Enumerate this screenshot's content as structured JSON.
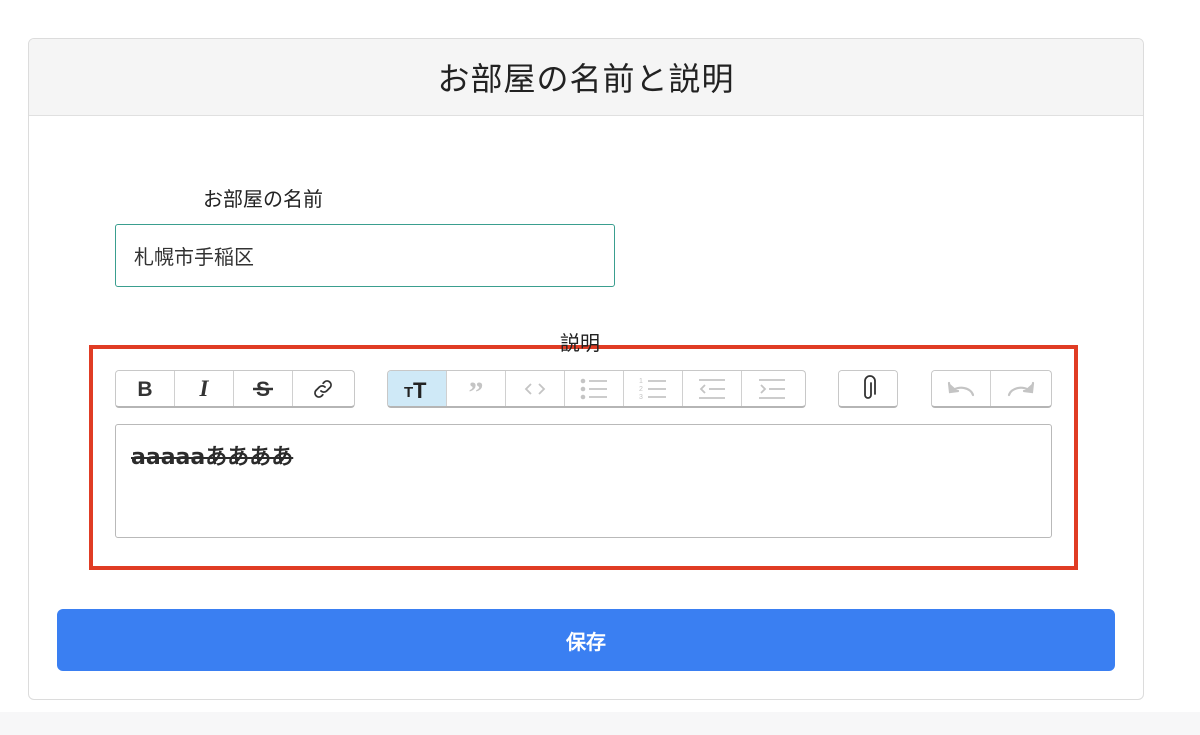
{
  "header": {
    "title": "お部屋の名前と説明"
  },
  "form": {
    "name_label": "お部屋の名前",
    "name_value": "札幌市手稲区",
    "description_label": "説明",
    "description_text": "aaaaaああああ",
    "save_label": "保存"
  },
  "toolbar": {
    "groups": [
      {
        "name": "text-format",
        "buttons": [
          "bold-icon",
          "italic-icon",
          "strikethrough-icon",
          "link-icon"
        ]
      },
      {
        "name": "block-format",
        "buttons": [
          "heading-icon",
          "quote-icon",
          "code-icon",
          "bullet-list-icon",
          "numbered-list-icon",
          "outdent-icon",
          "indent-icon"
        ]
      },
      {
        "name": "files",
        "buttons": [
          "attach-icon"
        ]
      },
      {
        "name": "history",
        "buttons": [
          "undo-icon",
          "redo-icon"
        ]
      }
    ],
    "active_button": "heading-icon"
  },
  "colors": {
    "highlight_border": "#e03c24",
    "save_button": "#3a7ff2",
    "input_border": "#3a9e8f",
    "active_tool": "#cfe9f7"
  }
}
